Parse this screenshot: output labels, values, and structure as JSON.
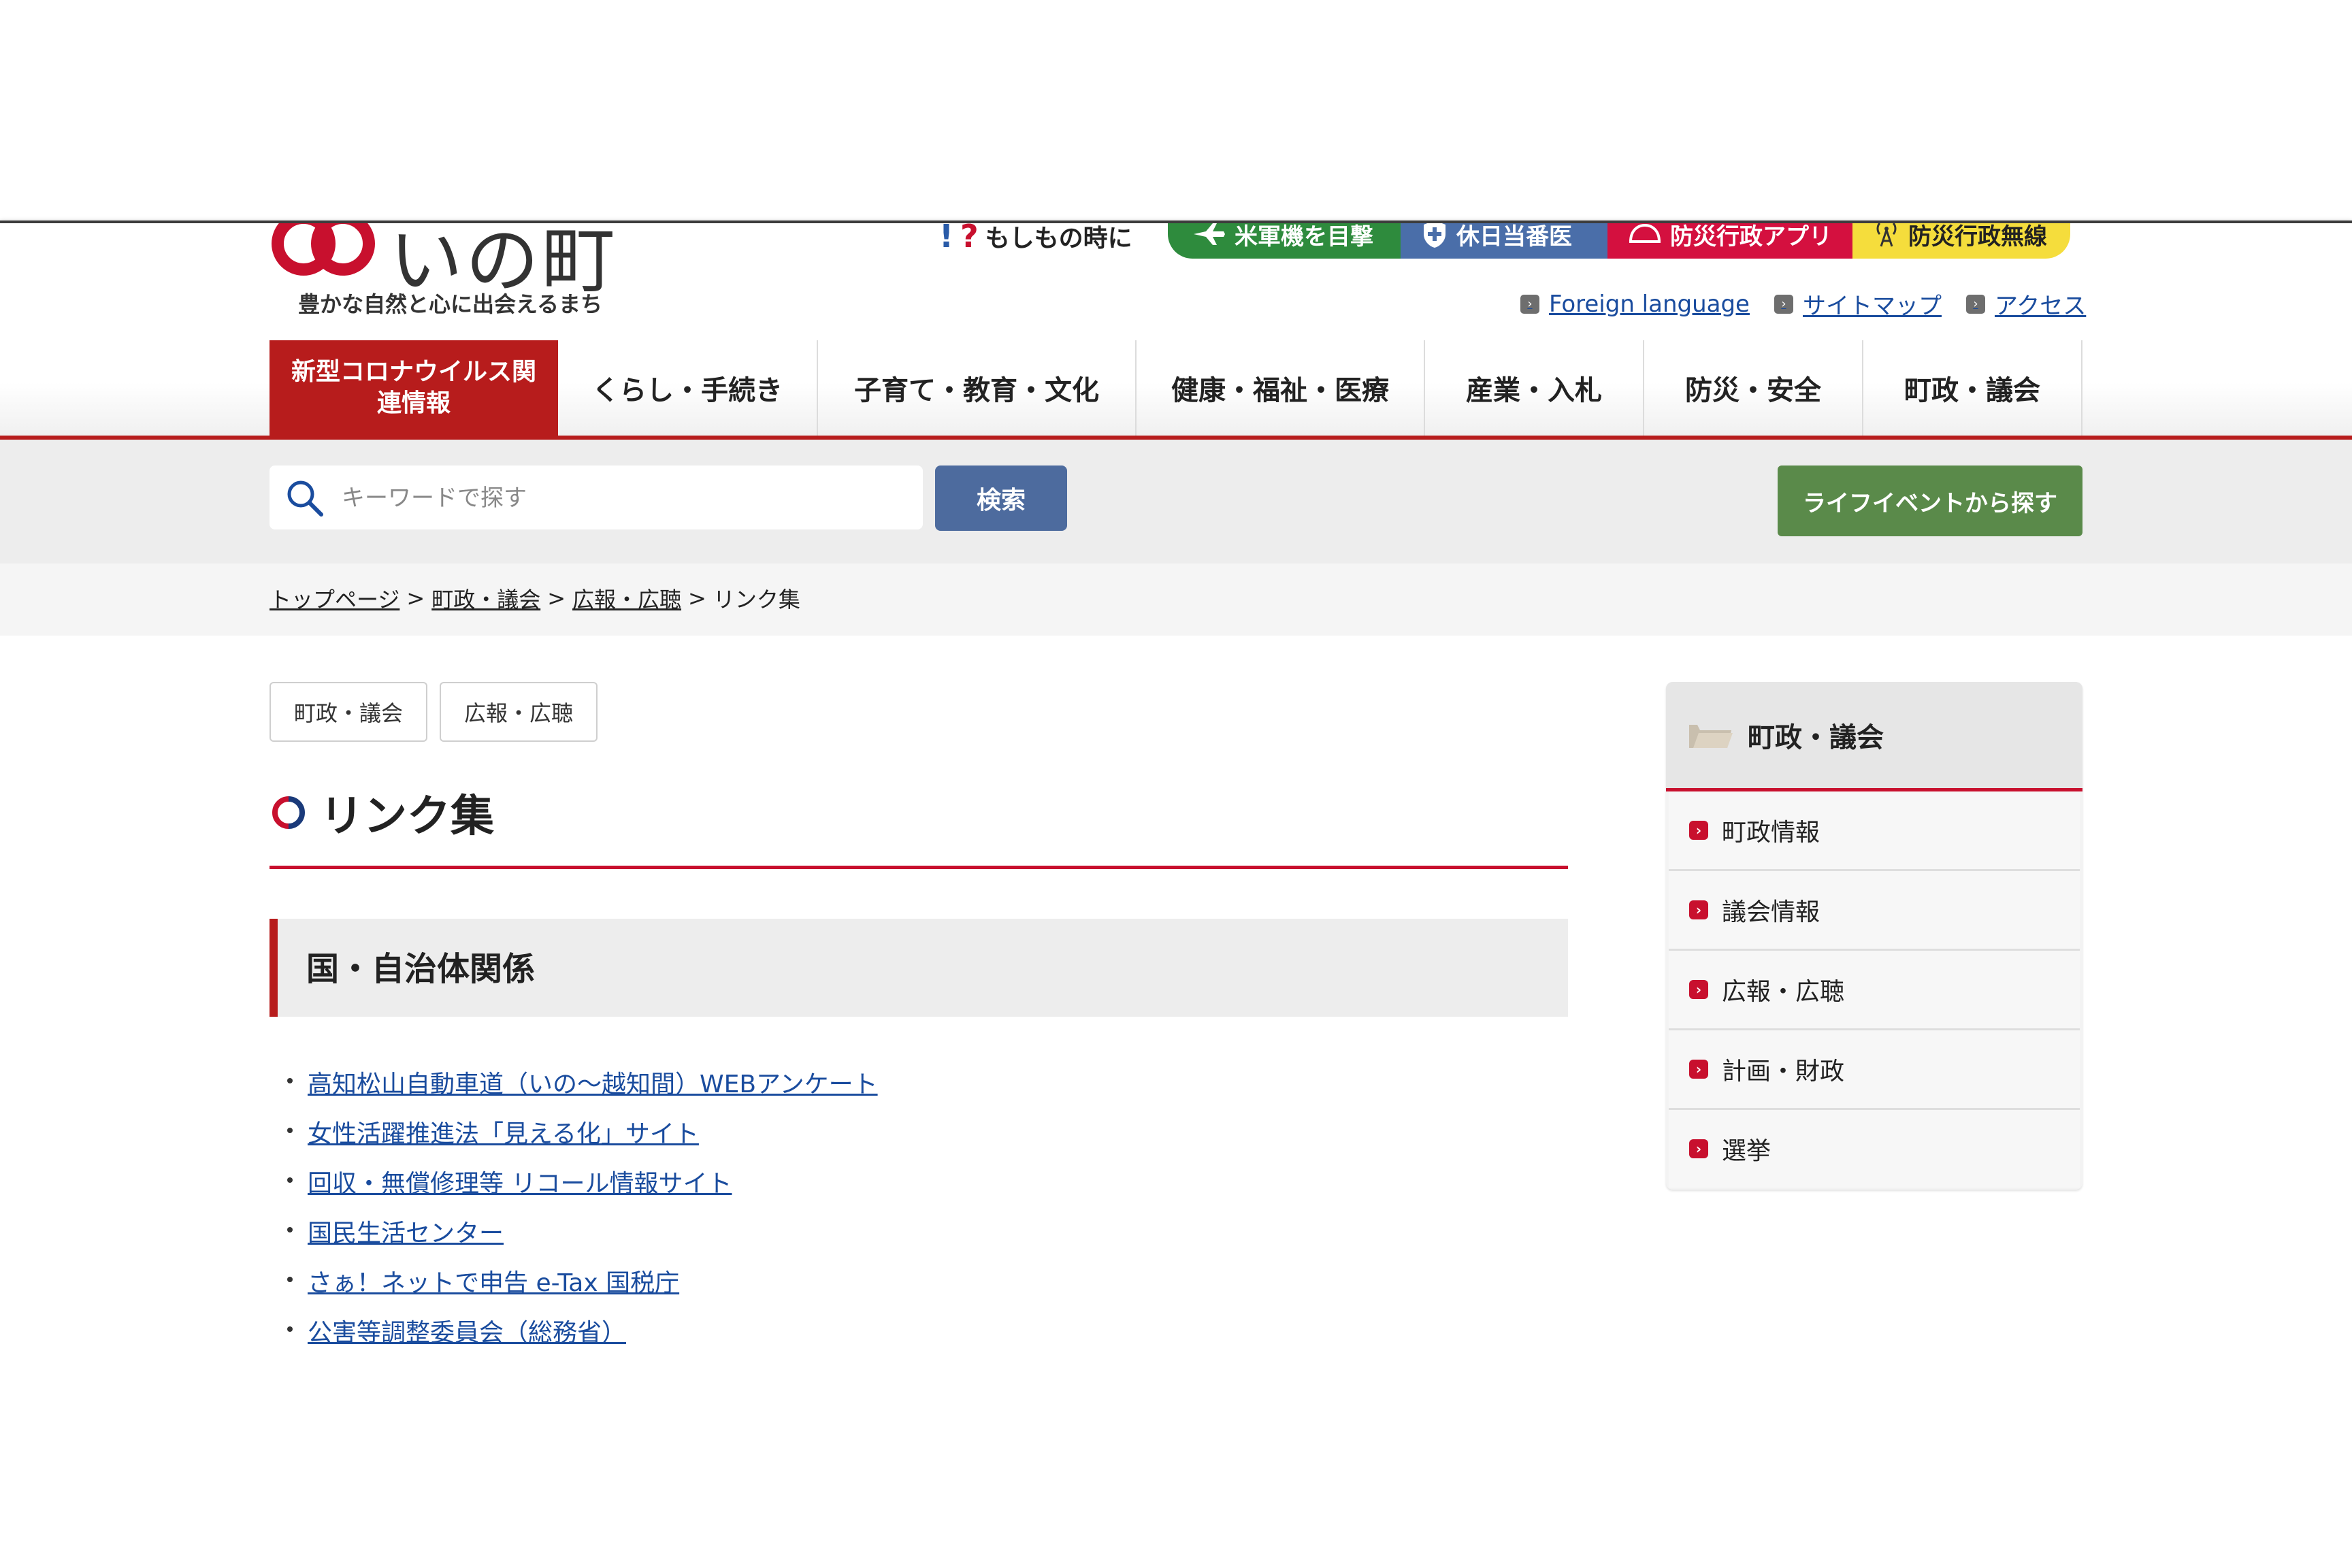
{
  "header": {
    "logo_text": "いの町",
    "tagline": "豊かな自然と心に出会えるまち",
    "emergency_label": "もしもの時に",
    "emergency_links": [
      "米軍機を目撃",
      "休日当番医",
      "防災行政アプリ",
      "防災行政無線"
    ],
    "util_links": [
      "Foreign language",
      "サイトマップ",
      "アクセス"
    ]
  },
  "nav": {
    "items": [
      "新型コロナウイルス関連情報",
      "くらし・手続き",
      "子育て・教育・文化",
      "健康・福祉・医療",
      "産業・入札",
      "防災・安全",
      "町政・議会"
    ]
  },
  "search": {
    "placeholder": "キーワードで探す",
    "button_label": "検索",
    "life_event_label": "ライフイベントから探す"
  },
  "breadcrumb": {
    "items": [
      "トップページ",
      "町政・議会",
      "広報・広聴"
    ],
    "current": "リンク集",
    "separator": ">"
  },
  "tags": [
    "町政・議会",
    "広報・広聴"
  ],
  "page": {
    "title": "リンク集",
    "section_heading": "国・自治体関係",
    "links": [
      "高知松山自動車道（いの～越知間）WEBアンケート",
      "女性活躍推進法「見える化」サイト",
      "回収・無償修理等 リコール情報サイト",
      "国民生活センター",
      "さぁ！ネットで申告 e-Tax 国税庁",
      "公害等調整委員会（総務省）"
    ]
  },
  "sidebar": {
    "title": "町政・議会",
    "items": [
      "町政情報",
      "議会情報",
      "広報・広聴",
      "計画・財政",
      "選挙"
    ]
  },
  "colors": {
    "brand_red": "#b71c1c",
    "link_blue": "#1a4c9e",
    "search_button": "#4d6b9e",
    "life_event_green": "#5a8a4a"
  }
}
